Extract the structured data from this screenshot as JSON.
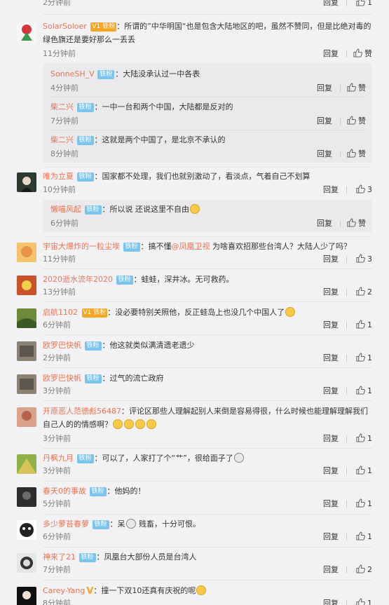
{
  "labels": {
    "reply": "回复",
    "like": "赞"
  },
  "top_partial": {
    "time": "2分钟前",
    "likes": "1"
  },
  "comments": [
    {
      "user": "SolarSoloer",
      "vip": "V1 铁粉",
      "text": "所谓的”中华明国“也是包含大陆地区的吧，虽然不赞同，但是比绝对毒的绿色旗还是要好那么一丢丢",
      "time": "11分钟前",
      "likes": "赞",
      "replies": [
        {
          "user": "SonneSH_V",
          "badge": "铁粉",
          "text": "大陆没承认过一中各表",
          "time": "4分钟前",
          "likes": "赞"
        },
        {
          "user": "柴二兴",
          "badge": "铁粉",
          "text": "一中一台和两个中国，大陆都是反对的",
          "time": "7分钟前",
          "likes": "赞"
        },
        {
          "user": "柴二兴",
          "badge": "铁粉",
          "text": "这就是两个中国了，是北京不承认的",
          "time": "8分钟前",
          "likes": "赞"
        }
      ]
    },
    {
      "user": "唯为立夏",
      "badge": "铁粉",
      "text": "国家都不处理，我们也就别激动了，看淡点，气着自己不划算",
      "time": "10分钟前",
      "likes": "3",
      "replies": [
        {
          "user": "懒喵风起",
          "badge": "铁粉",
          "text": "所以说 还说这里不自由",
          "time": "6分钟前",
          "likes": "赞"
        }
      ]
    },
    {
      "user": "宇宙大爆炸的一粒尘埃",
      "badge": "铁粉",
      "text_a": "搞不懂",
      "mention": "@凤凰卫视",
      "text_b": " 为啥喜欢招那些台湾人？大陆人少了吗？",
      "time": "11分钟前",
      "likes": "3"
    },
    {
      "user": "2020逝水流年2020",
      "badge": "铁粉",
      "text": "蛙蛙，深井冰。无可救药。",
      "time": "13分钟前",
      "likes": "2"
    },
    {
      "user": "启航1102",
      "vip": "V1 铁粉",
      "text": "没必要特别关照他，反正蛙岛上也没几个中国人了",
      "time": "6分钟前",
      "likes": "1"
    },
    {
      "user": "欧罗巴快帆",
      "badge": "铁粉",
      "text": "他这就类似满清遗老遗少",
      "time": "2分钟前",
      "likes": "1"
    },
    {
      "user": "欧罗巴快帆",
      "badge": "铁粉",
      "text": "过气的流亡政府",
      "time": "3分钟前",
      "likes": "1"
    },
    {
      "user": "开原恶人范德彪56487",
      "text": "评论区那些人理解起别人来倒是容易得很，什么时候也能理解理解我们自己人的的情感啊？",
      "time": "3分钟前",
      "likes": "1"
    },
    {
      "user": "丹枫九月",
      "badge": "铁粉",
      "text": "可以了，人家打了个“艹”，很给面子了",
      "time": "3分钟前",
      "likes": "1"
    },
    {
      "user": "春天0的事故",
      "badge": "铁粉",
      "text": "他妈的！",
      "time": "5分钟前",
      "likes": "1"
    },
    {
      "user": "多少萝苔春萝",
      "badge": "铁粉",
      "text": "呆",
      "text_b": " 贱畜，十分可恨。",
      "time": "6分钟前",
      "likes": "1"
    },
    {
      "user": "神来了21",
      "badge": "铁粉",
      "text": "凤凰台大部份人员是台湾人",
      "time": "7分钟前",
      "likes": "2"
    },
    {
      "user": "Carey-Yang",
      "text": "撞一下双10还真有庆祝的呢",
      "time": "8分钟前",
      "likes": "1"
    }
  ],
  "colors": {
    "username": "#eb7350",
    "badge": "#7ac4ee",
    "vip": "#f5a623",
    "background": "#f2f2f5"
  }
}
